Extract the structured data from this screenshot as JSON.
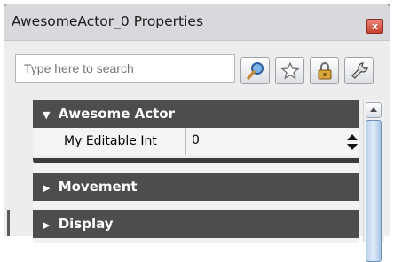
{
  "window": {
    "title": "AwesomeActor_0 Properties",
    "close_glyph": "x"
  },
  "search": {
    "placeholder": "Type here to search"
  },
  "toolbar": {
    "buttons": [
      "search-icon",
      "favorite-star-icon",
      "lock-icon",
      "wrench-icon"
    ]
  },
  "categories": [
    {
      "label": "Awesome Actor",
      "expanded": true,
      "properties": [
        {
          "name": "My Editable Int",
          "value": "0"
        }
      ]
    },
    {
      "label": "Movement",
      "expanded": false
    },
    {
      "label": "Display",
      "expanded": false
    }
  ],
  "glyphs": {
    "expanded_arrow": "▼",
    "collapsed_arrow": "▶"
  },
  "colors": {
    "category_header": "#4d4d4d",
    "titlebar": "#d7d9dc",
    "scroll_thumb": "#b9d2ee"
  }
}
